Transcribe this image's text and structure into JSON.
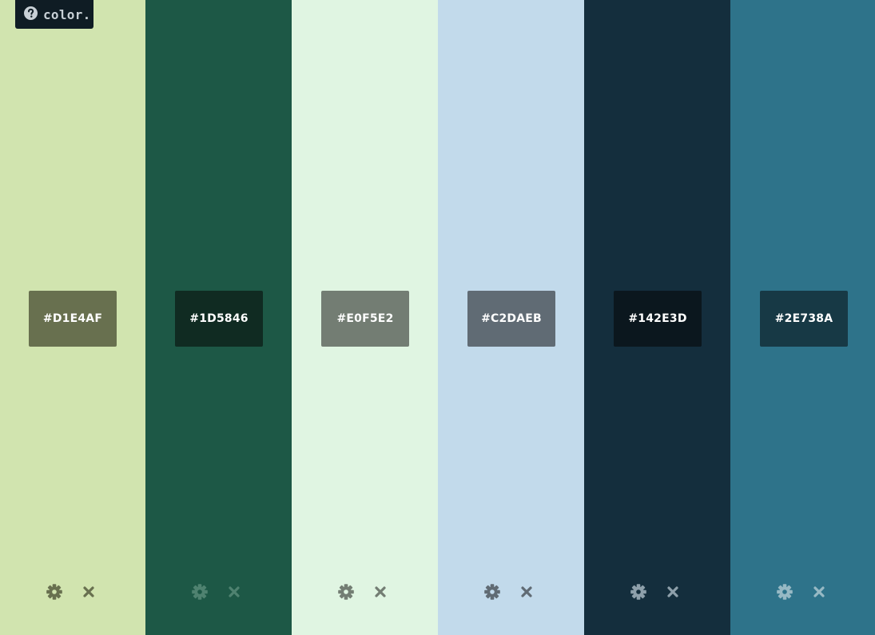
{
  "app": {
    "logo_text": "color.",
    "logo_icon": "help-circle-icon"
  },
  "columns": [
    {
      "color": "#D1E4AF",
      "hex_label": "#D1E4AF",
      "box_color": "#68704F",
      "icon_color": "#68704F"
    },
    {
      "color": "#1D5846",
      "hex_label": "#1D5846",
      "box_color": "#102B22",
      "icon_color": "#4F8270"
    },
    {
      "color": "#E0F5E2",
      "hex_label": "#E0F5E2",
      "box_color": "#737D73",
      "icon_color": "#737D73"
    },
    {
      "color": "#C2DAEB",
      "hex_label": "#C2DAEB",
      "box_color": "#606B74",
      "icon_color": "#606B74"
    },
    {
      "color": "#142E3D",
      "hex_label": "#142E3D",
      "box_color": "#0B171E",
      "icon_color": "#8EA0AB"
    },
    {
      "color": "#2E738A",
      "hex_label": "#2E738A",
      "box_color": "#173945",
      "icon_color": "#97B9C4"
    }
  ],
  "icons": {
    "settings": "gear-icon",
    "remove": "close-icon"
  }
}
